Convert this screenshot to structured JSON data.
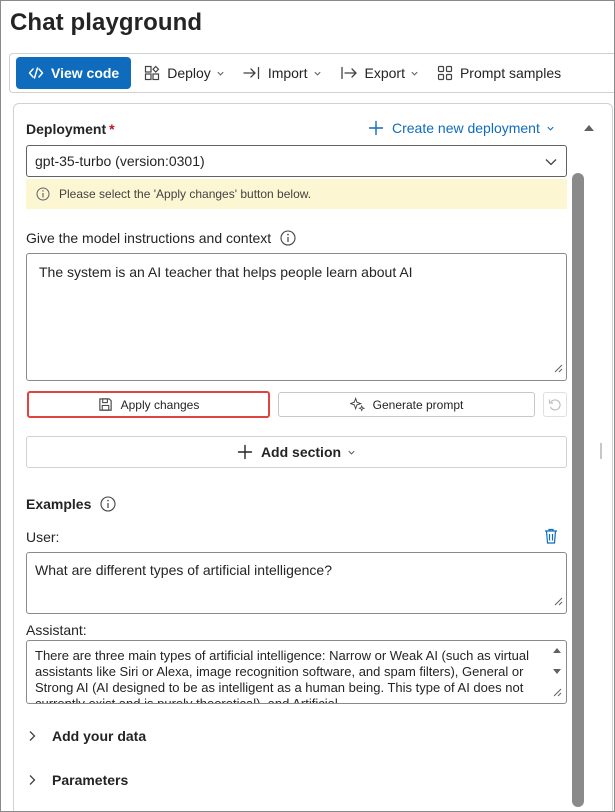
{
  "page": {
    "title": "Chat playground"
  },
  "toolbar": {
    "view_code": "View code",
    "deploy": "Deploy",
    "import": "Import",
    "export": "Export",
    "prompt_samples": "Prompt samples"
  },
  "deployment": {
    "label": "Deployment",
    "required_mark": "*",
    "create_new": "Create new deployment",
    "selected": "gpt-35-turbo (version:0301)",
    "warning": "Please select the 'Apply changes' button below."
  },
  "system_message": {
    "label": "Give the model instructions and context",
    "value": "The system is an AI teacher that helps people learn about AI",
    "apply_changes": "Apply changes",
    "generate_prompt": "Generate prompt",
    "add_section": "Add section"
  },
  "examples": {
    "label": "Examples",
    "user_label": "User:",
    "user_value": "What are different types of artificial intelligence?",
    "assistant_label": "Assistant:",
    "assistant_value": "There are three main types of artificial intelligence: Narrow or Weak AI (such as virtual assistants like Siri or Alexa, image recognition software, and spam filters), General or Strong AI (AI designed to be as intelligent as a human being. This type of AI does not currently exist and is purely theoretical), and Artificial..."
  },
  "sections": {
    "add_your_data": "Add your data",
    "parameters": "Parameters"
  },
  "colors": {
    "primary": "#0f6cbd",
    "warning_bg": "#fdf6d3",
    "highlight": "#e0443e",
    "required": "#c50f1f"
  },
  "icons": {
    "view_code": "code-icon",
    "deploy": "deploy-cube-icon",
    "import": "import-arrow-icon",
    "export": "export-arrow-icon",
    "prompt_samples": "grid-icon",
    "create_new": "plus-icon",
    "info": "info-icon",
    "apply": "save-disk-icon",
    "generate": "sparkle-icon",
    "reset": "undo-icon",
    "delete": "trash-icon"
  }
}
